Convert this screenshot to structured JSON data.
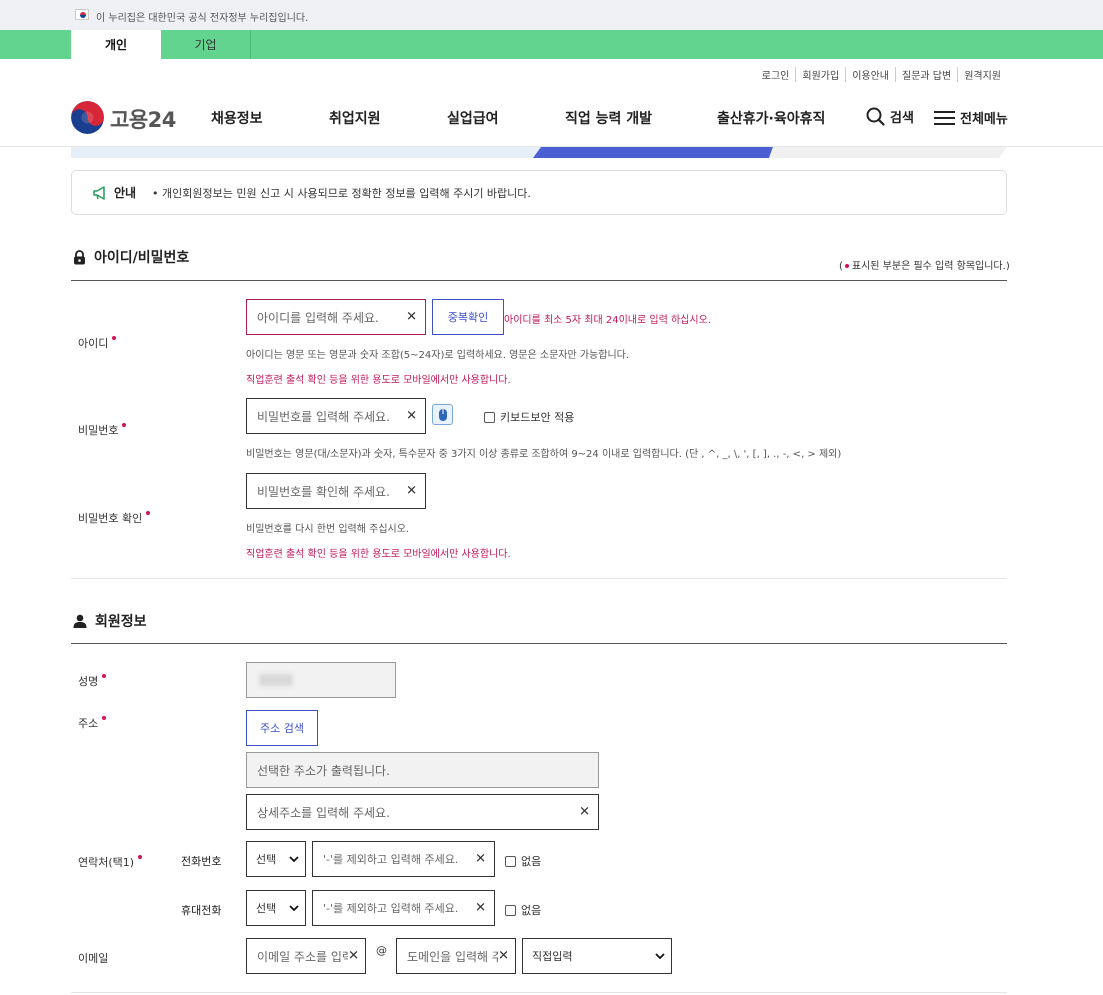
{
  "gov_banner": {
    "text": "이 누리집은 대한민국 공식 전자정부 누리집입니다."
  },
  "tabs": [
    {
      "label": "개인"
    },
    {
      "label": "기업"
    }
  ],
  "util_links": [
    "로그인",
    "회원가입",
    "이용안내",
    "질문과 답변",
    "원격지원"
  ],
  "header": {
    "logo_text": "고용24",
    "nav": [
      "채용정보",
      "취업지원",
      "실업급여",
      "직업 능력 개발",
      "출산휴가·육아휴직"
    ],
    "search_label": "검색",
    "menu_label": "전체메뉴"
  },
  "notice": {
    "label": "안내",
    "text": "• 개인회원정보는 민원 신고 시 사용되므로 정확한 정보를 입력해 주시기 바랍니다."
  },
  "account_section": {
    "title": "아이디/비밀번호",
    "required_note": "표시된 부분은 필수 입력 항목입니다.",
    "required_note_open": "(",
    "required_note_close": ")",
    "id": {
      "label": "아이디",
      "placeholder": "아이디를 입력해 주세요.",
      "check_button": "중복확인",
      "error": "아이디를 최소 5자 최대 24이내로 입력 하십시오.",
      "help": "아이디는 영문 또는 영문과 숫자 조합(5~24자)로 입력하세요. 영문은 소문자만 가능합니다.",
      "note": "직업훈련 출석 확인 등을 위한 용도로 모바일에서만 사용합니다."
    },
    "password": {
      "label": "비밀번호",
      "placeholder": "비밀번호를 입력해 주세요.",
      "keyboard_security": "키보드보안 적용",
      "help": "비밀번호는 영문(대/소문자)과 숫자, 특수문자 중 3가지 이상 종류로 조합하여 9~24 이내로 입력합니다. (단 , ^, _, \\, ', [, ], ., -, <, > 제외)"
    },
    "password_confirm": {
      "label": "비밀번호 확인",
      "placeholder": "비밀번호를 확인해 주세요.",
      "help": "비밀번호를 다시 한번 입력해 주십시오.",
      "note": "직업훈련 출석 확인 등을 위한 용도로 모바일에서만 사용합니다."
    }
  },
  "member_section": {
    "title": "회원정보",
    "name": {
      "label": "성명"
    },
    "address": {
      "label": "주소",
      "search_button": "주소 검색",
      "output_placeholder": "선택한 주소가 출력됩니다.",
      "detail_placeholder": "상세주소를 입력해 주세요."
    },
    "contact": {
      "label": "연락처(택1)",
      "phone_label": "전화번호",
      "mobile_label": "휴대전화",
      "select_value": "선택",
      "number_placeholder": "'-'를 제외하고 입력해 주세요.",
      "none_label": "없음"
    },
    "email": {
      "label": "이메일",
      "local_placeholder": "이메일 주소를 입력",
      "at": "@",
      "domain_placeholder": "도메인을 입력해 주",
      "domain_select": "직접입력"
    }
  },
  "colors": {
    "accent_green": "#62d490",
    "primary_blue": "#3f51c7",
    "required_pink": "#d4145a"
  }
}
